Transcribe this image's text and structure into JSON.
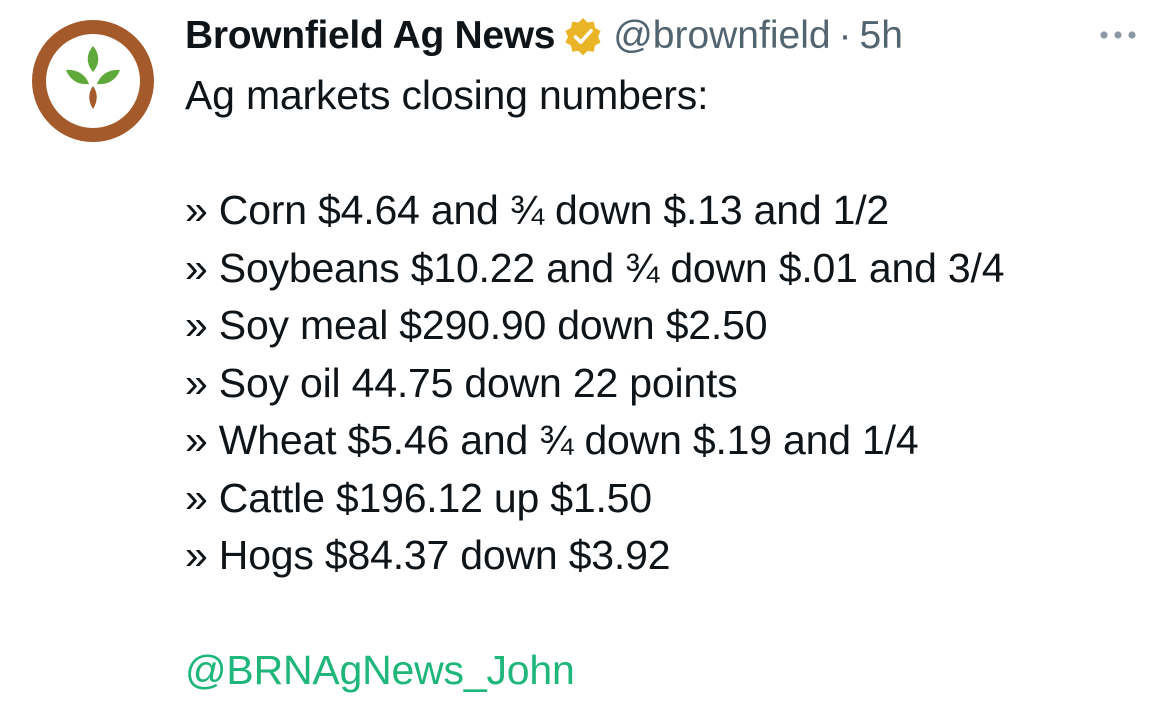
{
  "tweet": {
    "author": {
      "display_name": "Brownfield Ag News",
      "handle": "@brownfield",
      "separator": "·",
      "time": "5h",
      "verified_badge": "gold-verified-badge-icon",
      "avatar_icon": "brownfield-leaf-logo-icon"
    },
    "more_icon": "more-horizontal-icon",
    "text": {
      "intro": "Ag markets closing numbers:",
      "lines": [
        "» Corn $4.64 and ¾ down $.13 and 1/2",
        "» Soybeans $10.22 and ¾ down $.01 and 3/4",
        "» Soy meal $290.90 down $2.50",
        "» Soy oil 44.75 down 22 points",
        "» Wheat $5.46 and ¾ down $.19 and 1/4",
        "» Cattle $196.12 up $1.50",
        "» Hogs $84.37 down $3.92"
      ],
      "mention": "@BRNAgNews_John"
    }
  },
  "colors": {
    "text_primary": "#0f1419",
    "text_secondary": "#536471",
    "mention": "#1fb67a",
    "avatar_ring": "#a45a2a",
    "leaf_green": "#5fa83a",
    "verified_gold": "#e9b526"
  }
}
